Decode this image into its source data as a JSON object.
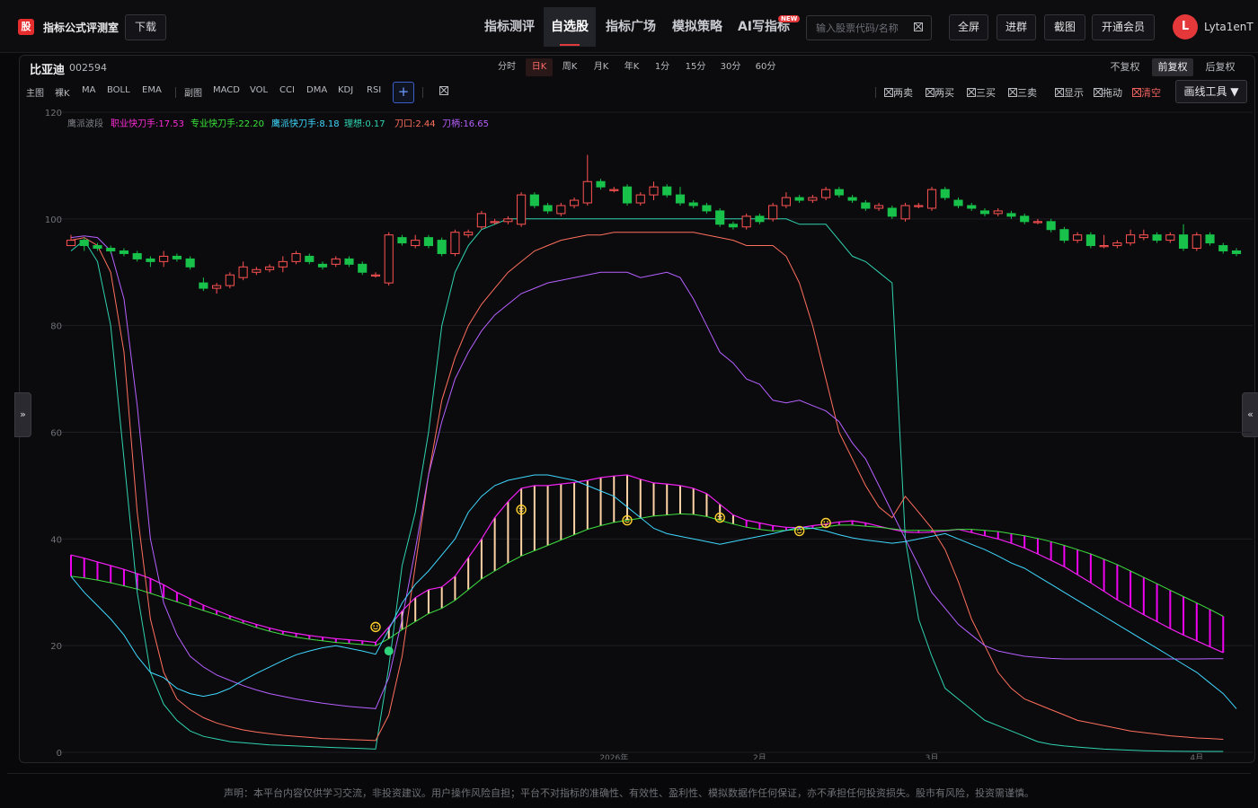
{
  "header": {
    "logo_text": "股",
    "brand": "指标公式评测室",
    "download": "下载",
    "nav": [
      "指标测评",
      "自选股",
      "指标广场",
      "模拟策略",
      "AI写指标"
    ],
    "nav_active": 1,
    "new_badge": "NEW",
    "search_placeholder": "输入股票代码/名称",
    "buttons": [
      "全屏",
      "进群",
      "截图",
      "开通会员"
    ],
    "avatar_letter": "L",
    "username": "Lyta1enT"
  },
  "stock": {
    "name": "比亚迪",
    "code": "002594"
  },
  "periods": [
    "分时",
    "日K",
    "周K",
    "月K",
    "年K",
    "1分",
    "15分",
    "30分",
    "60分"
  ],
  "period_active": 1,
  "adjust": [
    "不复权",
    "前复权",
    "后复权"
  ],
  "adjust_active": 1,
  "indicators": {
    "main_label": "主图",
    "main": [
      "裸K",
      "MA",
      "BOLL",
      "EMA"
    ],
    "sub_label": "副图",
    "sub": [
      "MACD",
      "VOL",
      "CCI",
      "DMA",
      "KDJ",
      "RSI"
    ],
    "add": "+"
  },
  "toggles": [
    "两卖",
    "两买",
    "三买",
    "三卖",
    "显示",
    "拖动",
    "清空"
  ],
  "draw_tool": "画线工具 ▼",
  "side_left": "»",
  "side_right": "«",
  "colors": {
    "up": "#ff5252",
    "down": "#18c24a",
    "ribbon": "#f000f0",
    "accent": "#e5383b"
  },
  "chart_data": {
    "type": "line",
    "legend_title": "鹰派波段",
    "legend": [
      {
        "label": "职业快刀手:17.53",
        "color": "#ff2bd9"
      },
      {
        "label": "专业快刀手:22.20",
        "color": "#39e639"
      },
      {
        "label": "鹰派快刀手:8.18",
        "color": "#3fd8ff"
      },
      {
        "label": "理想:0.17",
        "color": "#2fd3b0"
      },
      {
        "label": "刀口:2.44",
        "color": "#ff6f5e"
      },
      {
        "label": "刀柄:16.65",
        "color": "#b660ff"
      }
    ],
    "y_ticks": [
      0,
      20,
      40,
      60,
      80,
      100,
      120
    ],
    "ylim": [
      0,
      120
    ],
    "x_labels": [
      "2026年",
      "2月",
      "3月",
      "4月"
    ],
    "x_label_index": [
      41,
      52,
      65,
      85
    ],
    "candles": [
      [
        95,
        96,
        97,
        95
      ],
      [
        96,
        95,
        96.5,
        94
      ],
      [
        95,
        94.5,
        95.5,
        94
      ],
      [
        94.5,
        94,
        95,
        93.5
      ],
      [
        94,
        93.5,
        94.5,
        93
      ],
      [
        93.5,
        92.5,
        94,
        92
      ],
      [
        92.5,
        92,
        93,
        91
      ],
      [
        92,
        93,
        94,
        91
      ],
      [
        93,
        92.5,
        93.5,
        92
      ],
      [
        92.5,
        91,
        93,
        90.5
      ],
      [
        88,
        87,
        89,
        86.5
      ],
      [
        87,
        87.5,
        88,
        86
      ],
      [
        87.5,
        89.5,
        90,
        87
      ],
      [
        89,
        91,
        92,
        88.5
      ],
      [
        90,
        90.5,
        91,
        89.5
      ],
      [
        90.5,
        91,
        91.5,
        90
      ],
      [
        91,
        92,
        93,
        90
      ],
      [
        92,
        93.5,
        94,
        91.5
      ],
      [
        93,
        92,
        93.5,
        91.5
      ],
      [
        91.5,
        91,
        92,
        90.5
      ],
      [
        91.5,
        92.5,
        93,
        91
      ],
      [
        92.5,
        91.5,
        93,
        91
      ],
      [
        91.5,
        90,
        92,
        89.5
      ],
      [
        89.5,
        89.5,
        90,
        89
      ],
      [
        88,
        97,
        97.5,
        87.5
      ],
      [
        96.5,
        95.5,
        97,
        95
      ],
      [
        95,
        96,
        97,
        94.5
      ],
      [
        96.5,
        95,
        97,
        94.5
      ],
      [
        96,
        93.5,
        96.5,
        93
      ],
      [
        93.5,
        97.5,
        98,
        93
      ],
      [
        97,
        97.5,
        98,
        96.5
      ],
      [
        98.5,
        101,
        101.5,
        98
      ],
      [
        99.5,
        99.5,
        100,
        99
      ],
      [
        99.5,
        100,
        100.5,
        99
      ],
      [
        99,
        104.5,
        105,
        98.5
      ],
      [
        104.5,
        102.5,
        105,
        102
      ],
      [
        102.5,
        101.5,
        103,
        101
      ],
      [
        101,
        102.5,
        103,
        100.5
      ],
      [
        102.5,
        103.5,
        104,
        102
      ],
      [
        103,
        107,
        112,
        102.5
      ],
      [
        107,
        106,
        107.5,
        105.5
      ],
      [
        105.5,
        105.5,
        106,
        105
      ],
      [
        106,
        103,
        106.5,
        102.5
      ],
      [
        103,
        104.5,
        105,
        102.5
      ],
      [
        104.5,
        106,
        107,
        103.5
      ],
      [
        106,
        104.5,
        106.5,
        104
      ],
      [
        104.5,
        103,
        106,
        102.5
      ],
      [
        103,
        102.5,
        103.5,
        102
      ],
      [
        102.5,
        101.5,
        103,
        101
      ],
      [
        101.5,
        99,
        102,
        98.5
      ],
      [
        99,
        98.5,
        99.5,
        98
      ],
      [
        98.5,
        100.5,
        101,
        98
      ],
      [
        100.5,
        99.5,
        101,
        99
      ],
      [
        100,
        102.5,
        103,
        99.5
      ],
      [
        102.5,
        104,
        105,
        102
      ],
      [
        104,
        103.5,
        104.5,
        103
      ],
      [
        103.5,
        104,
        104.5,
        103
      ],
      [
        104,
        105.5,
        106,
        103.5
      ],
      [
        105.5,
        104.5,
        106,
        104
      ],
      [
        104,
        103.5,
        104.5,
        103
      ],
      [
        103,
        102,
        103.5,
        101.5
      ],
      [
        102,
        102.5,
        103,
        101.5
      ],
      [
        102,
        100.5,
        102.5,
        100
      ],
      [
        100,
        102.5,
        103,
        99.5
      ],
      [
        102.5,
        102.5,
        103,
        102
      ],
      [
        102,
        105.5,
        106,
        101.5
      ],
      [
        105.5,
        104,
        106,
        103.5
      ],
      [
        103.5,
        102.5,
        104,
        102
      ],
      [
        102.5,
        102,
        103,
        101.5
      ],
      [
        101.5,
        101,
        102,
        100.5
      ],
      [
        101,
        101.5,
        102,
        100.5
      ],
      [
        101,
        100.5,
        101.5,
        100
      ],
      [
        100.5,
        99.5,
        101,
        99
      ],
      [
        99.5,
        99.5,
        100,
        99
      ],
      [
        99.5,
        98,
        100,
        97.5
      ],
      [
        98,
        96,
        98.5,
        95.5
      ],
      [
        96,
        97,
        97.5,
        95.5
      ],
      [
        97,
        95,
        97.5,
        94.5
      ],
      [
        95,
        95,
        97,
        94.5
      ],
      [
        95,
        95.5,
        96,
        94.5
      ],
      [
        95.5,
        97,
        98,
        95
      ],
      [
        96.5,
        97,
        98,
        96
      ],
      [
        97,
        96,
        97.5,
        95.5
      ],
      [
        96,
        97,
        97.5,
        95.5
      ],
      [
        97,
        94.5,
        99,
        94
      ],
      [
        94.5,
        97,
        97.5,
        94
      ],
      [
        97,
        95.5,
        97.5,
        95
      ],
      [
        95,
        94,
        95.5,
        93.5
      ],
      [
        94,
        93.5,
        94.5,
        93
      ]
    ],
    "ribbon_upper": [
      37,
      36.4,
      35.7,
      35,
      34.3,
      33.5,
      32.6,
      31.4,
      30,
      28.8,
      27.6,
      26.6,
      25.6,
      24.7,
      24,
      23.3,
      22.7,
      22.3,
      21.9,
      21.6,
      21.3,
      21.1,
      20.9,
      20.6,
      23.5,
      26.5,
      29,
      30.5,
      31,
      33,
      36.5,
      40,
      44,
      47,
      49.5,
      50,
      50,
      50.3,
      50.6,
      51,
      51.5,
      51.8,
      52,
      51.2,
      50.5,
      50.3,
      50,
      49.5,
      48.5,
      46.5,
      44.5,
      43.5,
      43,
      42.5,
      42.2,
      42.1,
      42.5,
      42.8,
      43.2,
      43.4,
      43,
      42.4,
      41.8,
      41.3,
      41.2,
      41.3,
      41.5,
      41.8,
      41.2,
      40.6,
      40,
      39.2,
      38.3,
      37.2,
      36,
      34.8,
      33.3,
      31.8,
      30.2,
      28.6,
      27.2,
      25.8,
      24.5,
      23.2,
      22,
      20.9,
      19.8,
      18.7
    ],
    "ribbon_lower": [
      33,
      32.7,
      32.3,
      31.8,
      31.2,
      30.6,
      29.8,
      29,
      28.2,
      27.4,
      26.6,
      25.8,
      25,
      24.2,
      23.4,
      22.7,
      22.1,
      21.6,
      21.2,
      20.9,
      20.6,
      20.4,
      20.2,
      20,
      21.3,
      23,
      24.5,
      26,
      27,
      28.5,
      30.5,
      32.5,
      34,
      35.5,
      36.8,
      37.8,
      38.8,
      39.8,
      40.8,
      41.8,
      42.5,
      43.1,
      43.5,
      43.9,
      44.3,
      44.5,
      44.7,
      44.6,
      44.2,
      43.5,
      42.8,
      42.2,
      41.8,
      41.5,
      41.6,
      41.8,
      42,
      42.3,
      42.6,
      42.6,
      42.4,
      42.2,
      41.9,
      41.6,
      41.6,
      41.6,
      41.6,
      41.8,
      41.8,
      41.6,
      41.4,
      41,
      40.6,
      40.1,
      39.5,
      38.8,
      38,
      37.2,
      36.2,
      35.2,
      34,
      32.8,
      31.6,
      30.4,
      29.2,
      28,
      26.8,
      25.5
    ],
    "series_lines": [
      {
        "color": "#2fd3b0",
        "values": [
          94,
          96,
          92,
          80,
          55,
          30,
          15,
          9,
          6,
          4,
          3,
          2.5,
          2,
          1.8,
          1.6,
          1.4,
          1.3,
          1.2,
          1.1,
          1,
          0.9,
          0.8,
          0.7,
          0.6,
          16,
          35,
          45,
          60,
          80,
          90,
          95,
          98,
          99,
          100,
          100,
          100,
          100,
          100,
          100,
          100,
          100,
          100,
          100,
          100,
          100,
          100,
          100,
          100,
          100,
          100,
          100,
          100,
          100,
          100,
          100,
          99,
          99,
          99,
          96,
          93,
          92,
          90,
          88,
          40,
          25,
          18,
          12,
          10,
          8,
          6,
          5,
          4,
          3,
          2,
          1.5,
          1.2,
          1,
          0.8,
          0.6,
          0.5,
          0.4,
          0.3,
          0.25,
          0.2,
          0.18,
          0.17,
          0.17,
          0.17
        ]
      },
      {
        "color": "#ff6f5e",
        "values": [
          96,
          96.5,
          95,
          90,
          75,
          45,
          25,
          15,
          10,
          8,
          6.5,
          5.5,
          4.8,
          4.2,
          3.8,
          3.5,
          3.2,
          3,
          2.8,
          2.6,
          2.5,
          2.4,
          2.3,
          2.2,
          7,
          18,
          35,
          52,
          66,
          74,
          80,
          84,
          87,
          90,
          92,
          94,
          95,
          96,
          96.5,
          97,
          97,
          97.5,
          97.5,
          97.5,
          97.5,
          97.5,
          97.5,
          97.5,
          97,
          96.5,
          96,
          95,
          95,
          95,
          93,
          88,
          80,
          70,
          60,
          55,
          50,
          46,
          44,
          48,
          45,
          42,
          38,
          32,
          25,
          20,
          15,
          12,
          10,
          9,
          8,
          7,
          6,
          5.5,
          5,
          4.5,
          4,
          3.7,
          3.4,
          3.1,
          2.9,
          2.7,
          2.6,
          2.44
        ]
      },
      {
        "color": "#b660ff",
        "values": [
          96.5,
          96.8,
          96.5,
          94,
          85,
          65,
          40,
          28,
          22,
          18,
          16,
          14.5,
          13.5,
          12.5,
          11.7,
          11,
          10.5,
          10,
          9.6,
          9.2,
          8.9,
          8.6,
          8.4,
          8.2,
          14,
          25,
          38,
          52,
          62,
          70,
          75,
          79,
          82,
          84,
          86,
          87,
          88,
          88.5,
          89,
          89.5,
          90,
          90,
          90,
          89,
          89.5,
          90,
          89,
          85,
          80,
          75,
          73,
          70,
          69,
          66,
          65.5,
          66,
          65,
          64,
          62,
          58,
          55,
          50,
          45,
          40,
          35,
          30,
          27,
          24,
          22,
          20,
          19,
          18.5,
          18,
          17.8,
          17.6,
          17.5,
          17.5,
          17.5,
          17.5,
          17.5,
          17.5,
          17.5,
          17.5,
          17.5,
          17.5,
          17.5,
          17.53,
          17.53
        ]
      },
      {
        "color": "#3fd8ff",
        "values": [
          33,
          30,
          27.5,
          25,
          22,
          18,
          15,
          14,
          12,
          11,
          10.5,
          11,
          12,
          13.5,
          14.8,
          16,
          17.2,
          18.3,
          19,
          19.6,
          20,
          19.5,
          19,
          18.4,
          23,
          28,
          31.5,
          34,
          37,
          40,
          45,
          48,
          50,
          51,
          51.5,
          52,
          52,
          51.5,
          51,
          50,
          49,
          48,
          46,
          44,
          42,
          41,
          40.5,
          40,
          39.5,
          39,
          39.5,
          40,
          40.5,
          41,
          41.6,
          42.2,
          42,
          41.5,
          40.8,
          40.2,
          39.8,
          39.5,
          39.2,
          39.5,
          40,
          40.5,
          41,
          40,
          39,
          38,
          36.8,
          35.5,
          34.5,
          33,
          31.5,
          30,
          28.5,
          27,
          25.5,
          24,
          22.5,
          21,
          19.5,
          18,
          16.5,
          15,
          13,
          11,
          8.18
        ]
      }
    ],
    "signals": [
      {
        "index": 23,
        "value": 23.5,
        "kind": "smiley"
      },
      {
        "index": 34,
        "value": 45.5,
        "kind": "smiley"
      },
      {
        "index": 42,
        "value": 43.5,
        "kind": "smiley"
      },
      {
        "index": 49,
        "value": 44,
        "kind": "smiley"
      },
      {
        "index": 55,
        "value": 41.5,
        "kind": "smiley"
      },
      {
        "index": 57,
        "value": 43,
        "kind": "smiley"
      },
      {
        "index": 24,
        "value": 19,
        "kind": "dot"
      }
    ]
  },
  "disclaimer": "声明：本平台内容仅供学习交流，非投资建议。用户操作风险自担；平台不对指标的准确性、有效性、盈利性、模拟数据作任何保证，亦不承担任何投资损失。股市有风险，投资需谨慎。"
}
